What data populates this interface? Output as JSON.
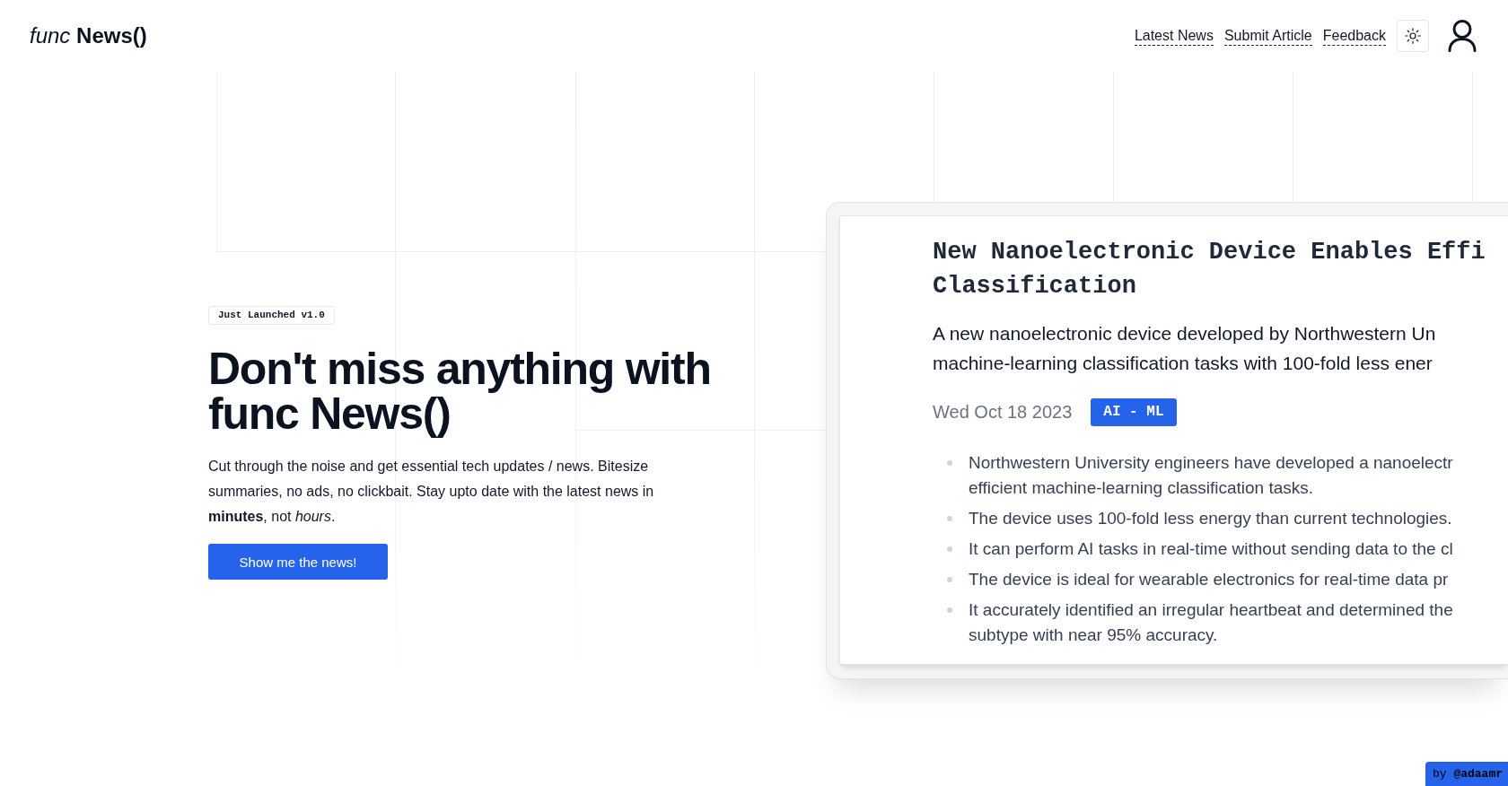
{
  "header": {
    "logo": "*func* **News()**",
    "nav": [
      {
        "label": "Latest News"
      },
      {
        "label": "Submit Article"
      },
      {
        "label": "Feedback"
      }
    ]
  },
  "hero": {
    "badge": "Just Launched v1.0",
    "heading": "Don't miss anything with func News()",
    "description": "Cut through the noise and get essential tech updates / news. Bitesize summaries, no ads, no clickbait. Stay upto date with the latest news in **minutes**, not *hours*.",
    "cta": "Show me the news!"
  },
  "preview": {
    "title_lines": [
      "New Nanoelectronic Device Enables Effi",
      "Classification"
    ],
    "summary_lines": [
      "A new nanoelectronic device developed by Northwestern Un",
      "machine-learning classification tasks with 100-fold less ener"
    ],
    "date": "Wed Oct 18 2023",
    "tag": "AI - ML",
    "bullets": [
      {
        "lines": [
          "Northwestern University engineers have developed a nanoelectr",
          "efficient machine-learning classification tasks."
        ]
      },
      {
        "lines": [
          "The device uses 100-fold less energy than current technologies."
        ]
      },
      {
        "lines": [
          "It can perform AI tasks in real-time without sending data to the cl"
        ]
      },
      {
        "lines": [
          "The device is ideal for wearable electronics for real-time data pr"
        ]
      },
      {
        "lines": [
          "It accurately identified an irregular heartbeat and determined the",
          "subtype with near 95% accuracy."
        ]
      }
    ]
  },
  "credit": "by **@adaamr**"
}
